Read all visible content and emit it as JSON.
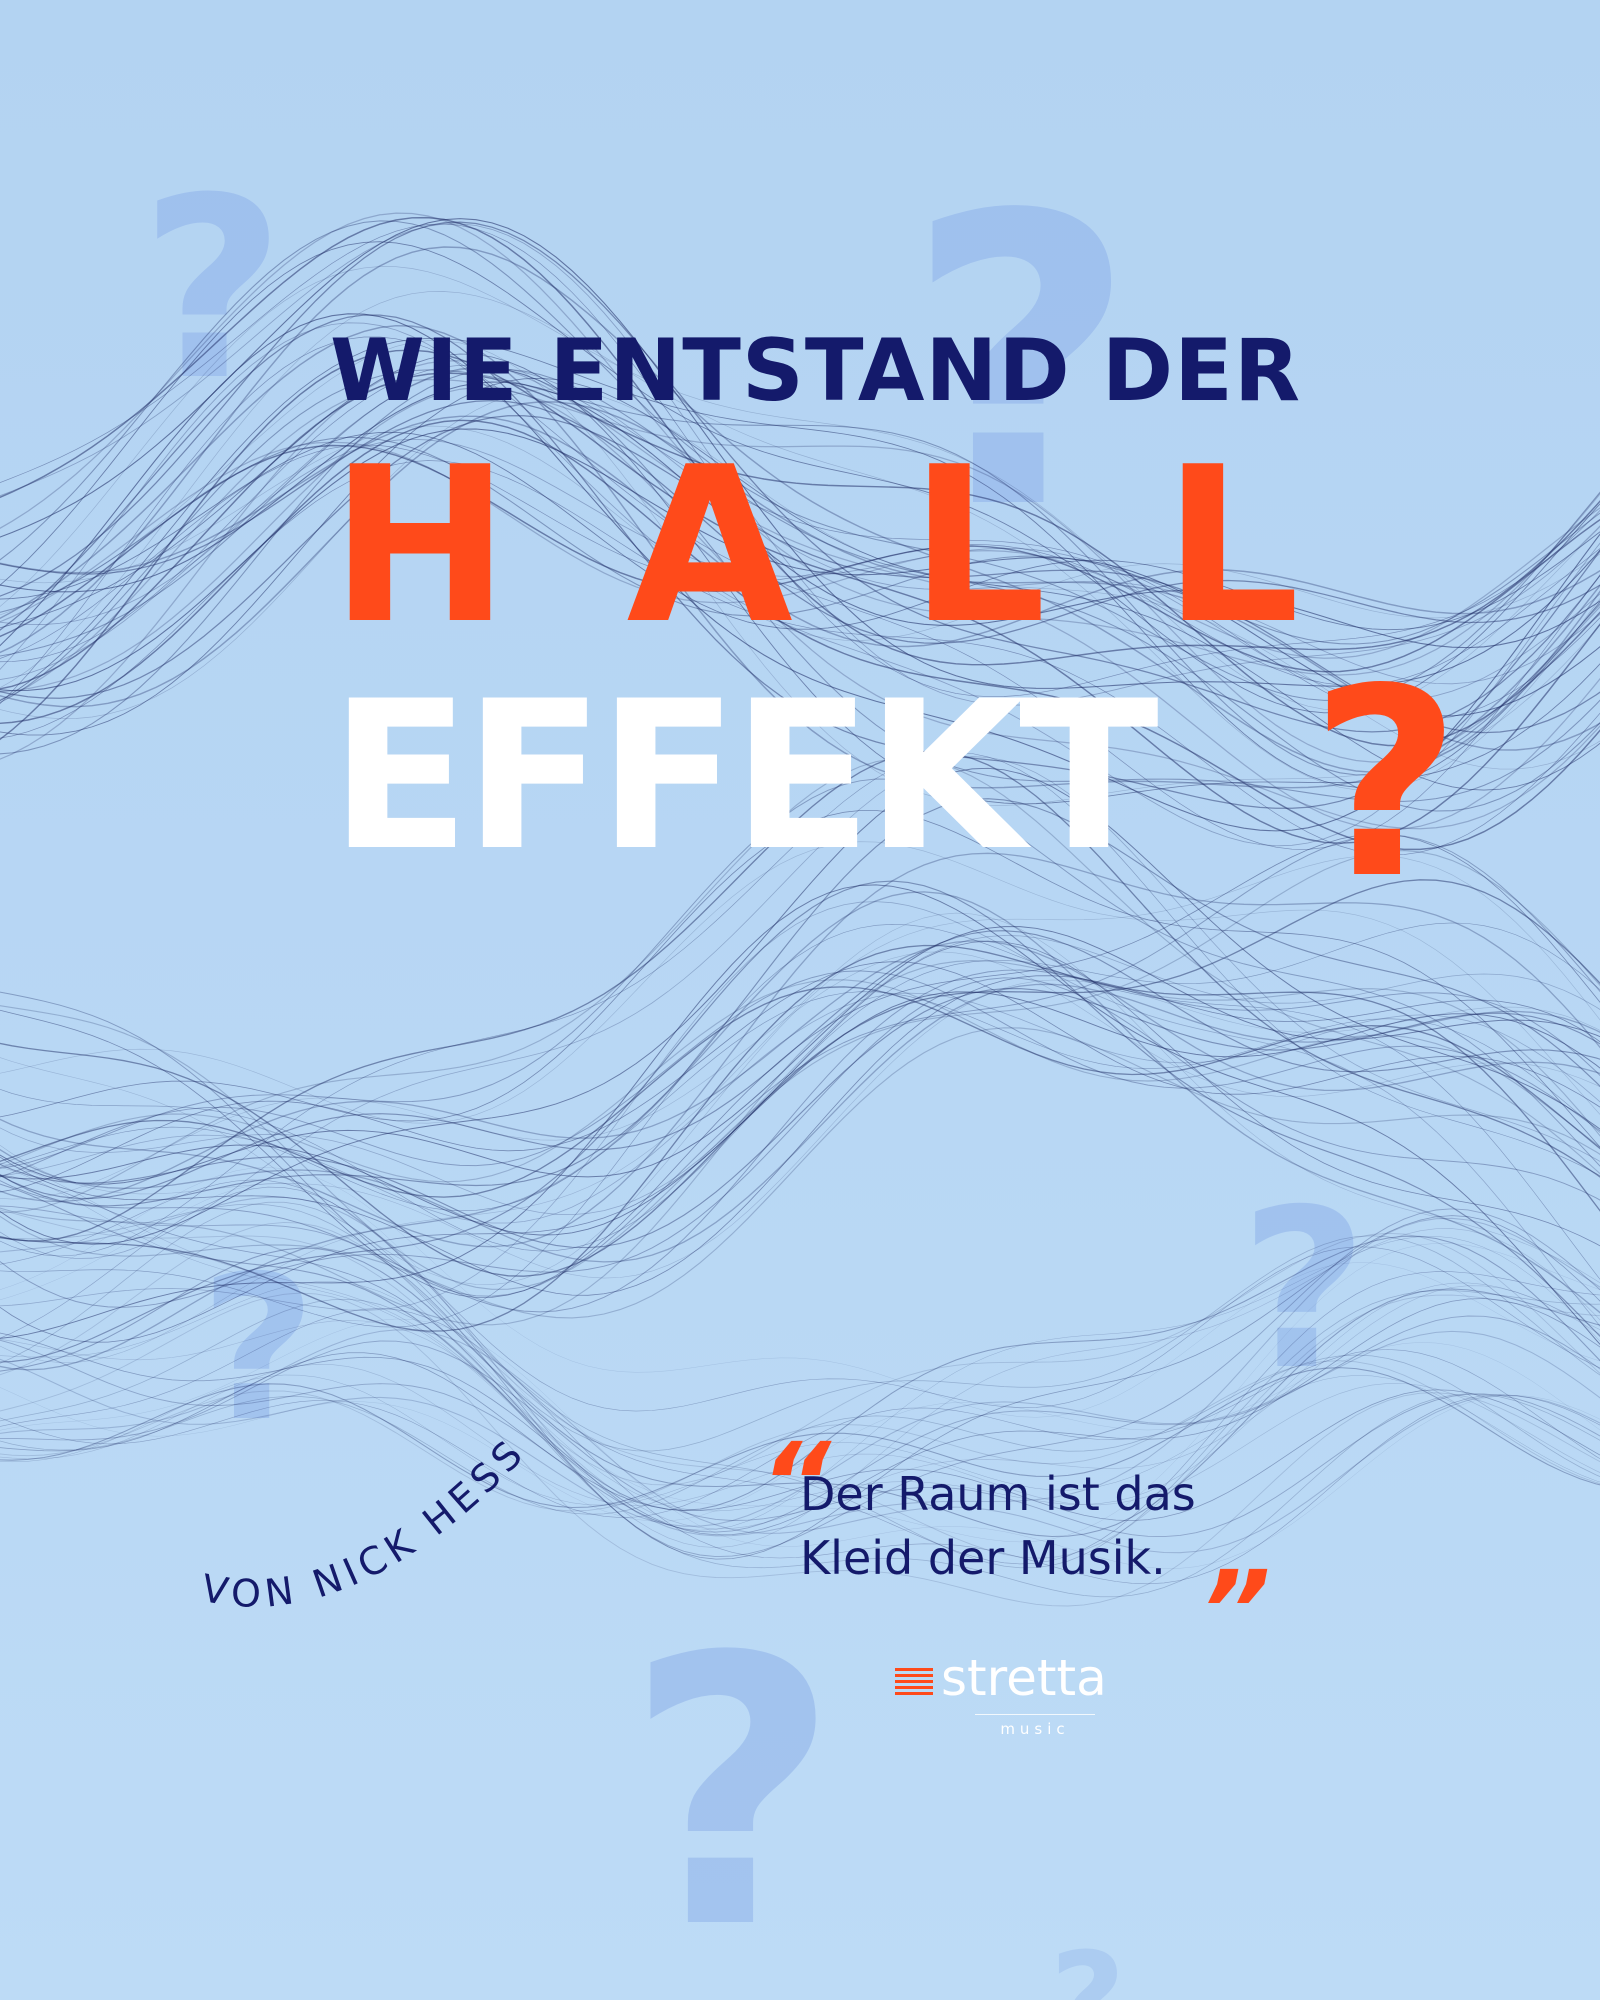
{
  "poster": {
    "headline": {
      "line1": "WIE ENTSTAND DER",
      "line2_letters": [
        "H",
        "A",
        "L",
        "L"
      ],
      "line3": "EFFEKT",
      "line3_qmark": "?"
    },
    "byline": "VON NICK HESS",
    "quote": {
      "open_mark": "“",
      "close_mark": "”",
      "line1": "Der Raum ist das",
      "line2": "Kleid der Musik."
    },
    "brand": {
      "name": "stretta",
      "tagline": "music"
    },
    "decorations": {
      "glyph": "?",
      "colors": {
        "background": "#b8d7f4",
        "navy": "#141a6b",
        "accent": "#ff4a1a",
        "wave_lines": "#1e2c66",
        "faint_glyph": "#8fb2ea"
      }
    }
  }
}
